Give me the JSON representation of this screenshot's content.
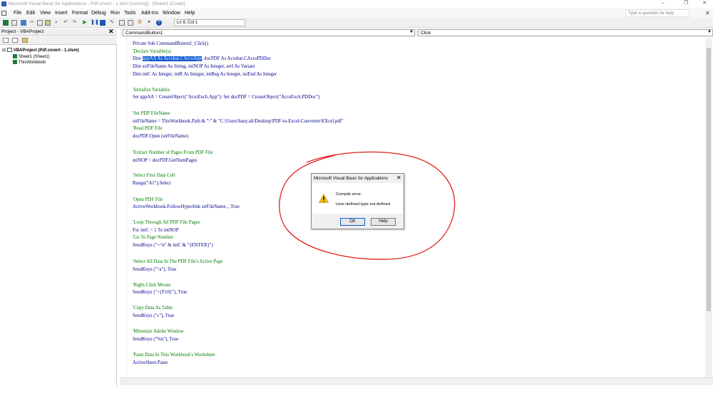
{
  "window": {
    "title": "Microsoft Visual Basic for Applications - Pdf.covert - 1.xlsm [running] - [Sheet1 (Code)]",
    "minimize": "–",
    "restore": "❐",
    "close": "✕"
  },
  "menu": {
    "items": [
      "File",
      "Edit",
      "View",
      "Insert",
      "Format",
      "Debug",
      "Run",
      "Tools",
      "Add-Ins",
      "Window",
      "Help"
    ],
    "help_placeholder": "Type a question for help",
    "close_mdi": "✕"
  },
  "toolbar": {
    "position_readout": "Ln 9, Col 1"
  },
  "project_explorer": {
    "title": "Project - VBAProject",
    "close": "✕",
    "root": "VBAProject (Pdf.covert - 1.xlsm)",
    "children": [
      "Sheet1 (Sheet1)",
      "ThisWorkbook"
    ]
  },
  "code_window": {
    "object_combo": "CommandButton1",
    "proc_combo": "Click",
    "lines": {
      "l01": "Private Sub CommandButton1_Click()",
      "l02": "'Declare Variable(s)",
      "l03_a": "Dim ",
      "l03_sel": "appAA As Acrobat.CAcroApp",
      "l03_b": ", docPDF As Acrobat.CAcroPDDoc",
      "l04": "Dim strFileName As String, intNOP As Integer, arrI As Variant",
      "l05": "Dim intC As Integer, intR As Integer, intBeg As Integer, intEnd As Integer",
      "l06": "'Initialize Variables",
      "l07": "Set appAA = CreateObject(\"AcroExch.App\"): Set docPDF = CreateObject(\"AcroExch.PDDoc\")",
      "l08": "'Set PDF FileName",
      "l09": "strFileName = ThisWorkbook.Path & \"\\\" & \"C:\\Users\\hany.ali\\Desktop\\PDF-to-Excel-Converter\\EXcel.pdf\"",
      "l10": "'Read PDF File",
      "l11": "docPDF.Open (strFileName)",
      "l12": "'Extract Number of Pages From PDF File",
      "l13": "intNOP = docPDF.GetNumPages",
      "l14": "'Select First Data Cell",
      "l15": "Range(\"A1\").Select",
      "l16": "'Open PDF File",
      "l17": "ActiveWorkbook.FollowHyperlink strFileName, , True",
      "l18": "'Loop Through All PDF File Pages",
      "l19": "For intC = 1 To intNOP",
      "l20": "'Go To Page Number",
      "l21": "SendKeys (\"+^n\" & intC & \"{ENTER}\")",
      "l22": "'Select All Data In The PDF File's Active Page",
      "l23": "SendKeys (\"^a\"), True",
      "l24": "'Right-Click Mouse",
      "l25": "SendKeys (\"+{F10}\"), True",
      "l26": "'Copy Data As Table",
      "l27": "SendKeys (\"c\"), True",
      "l28": "'Minimize Adobe Window",
      "l29": "SendKeys (\"%n\"), True",
      "l30": "'Paste Data In This Workbook's Worksheet",
      "l31": "ActiveSheet.Paste"
    }
  },
  "dialog": {
    "title": "Microsoft Visual Basic for Applications",
    "close": "✕",
    "message_title": "Compile error:",
    "message": "User-defined type not defined",
    "ok_label": "OK",
    "help_label": "Help"
  },
  "colors": {
    "keyword": "#00008b",
    "comment": "#007a00",
    "selection": "#0b57d0",
    "annotation": "#e0201b"
  }
}
